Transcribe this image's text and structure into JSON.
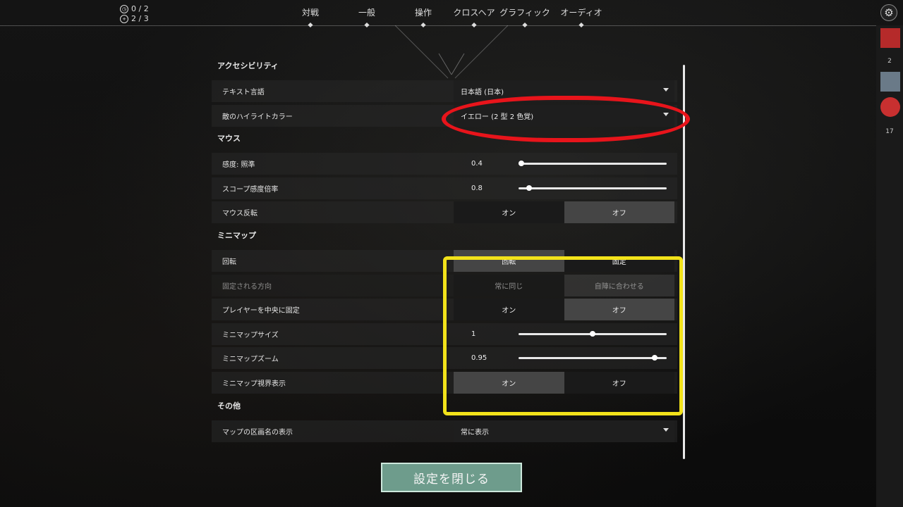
{
  "stats": [
    {
      "icon": "clock-icon",
      "text": "0 / 2"
    },
    {
      "icon": "plus-circle-icon",
      "text": "2 / 3"
    }
  ],
  "tabs": [
    {
      "label": "対戦"
    },
    {
      "label": "一般"
    },
    {
      "label": "操作"
    },
    {
      "label": "クロスヘア"
    },
    {
      "label": "グラフィック"
    },
    {
      "label": "オーディオ"
    }
  ],
  "rail": {
    "count1": "2",
    "count2": "17"
  },
  "sections": {
    "accessibility": "アクセシビリティ",
    "mouse": "マウス",
    "minimap": "ミニマップ",
    "other": "その他"
  },
  "rows": {
    "text_language": {
      "label": "テキスト言語",
      "value": "日本語 (日本)"
    },
    "enemy_highlight": {
      "label": "敵のハイライトカラー",
      "value": "イエロー (2 型 2 色覚)"
    },
    "sensitivity": {
      "label": "感度: 照準",
      "value": "0.4",
      "fraction": 0.02
    },
    "scope_sensitivity": {
      "label": "スコープ感度倍率",
      "value": "0.8",
      "fraction": 0.07
    },
    "invert_mouse": {
      "label": "マウス反転",
      "on": "オン",
      "off": "オフ",
      "selected": "off"
    },
    "rotate": {
      "label": "回転",
      "on": "回転",
      "off": "固定",
      "selected": "on"
    },
    "fixed_direction": {
      "label": "固定される方向",
      "on": "常に同じ",
      "off": "自陣に合わせる",
      "selected": "off"
    },
    "center_player": {
      "label": "プレイヤーを中央に固定",
      "on": "オン",
      "off": "オフ",
      "selected": "off"
    },
    "minimap_size": {
      "label": "ミニマップサイズ",
      "value": "1",
      "fraction": 0.5
    },
    "minimap_zoom": {
      "label": "ミニマップズーム",
      "value": "0.95",
      "fraction": 0.92
    },
    "minimap_vision": {
      "label": "ミニマップ視界表示",
      "on": "オン",
      "off": "オフ",
      "selected": "on"
    },
    "map_region_names": {
      "label": "マップの区画名の表示",
      "value": "常に表示"
    }
  },
  "close_button": "設定を閉じる",
  "colors": {
    "annotation_red": "#e8141b",
    "annotation_yellow": "#f2e21a",
    "close_button": "#6e9c8c"
  }
}
